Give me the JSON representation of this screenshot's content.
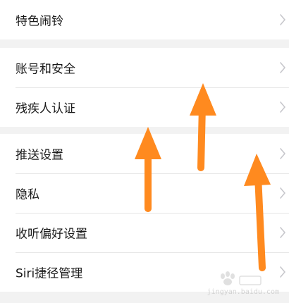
{
  "groups": [
    {
      "items": [
        {
          "label": "特色闹铃"
        }
      ]
    },
    {
      "items": [
        {
          "label": "账号和安全"
        },
        {
          "label": "残疾人认证"
        }
      ]
    },
    {
      "items": [
        {
          "label": "推送设置"
        },
        {
          "label": "隐私"
        },
        {
          "label": "收听偏好设置"
        },
        {
          "label": "Siri捷径管理"
        }
      ]
    }
  ],
  "icons": {
    "row_arrow": "chevron-right-icon",
    "annotation": "up-arrow-icon"
  },
  "colors": {
    "page_background": "#f2f2f2",
    "card_background": "#ffffff",
    "text": "#1a1a1a",
    "chevron": "#c7c7cc",
    "annotation_arrow": "#ff8a1f"
  },
  "watermark": {
    "text": "jingyan.baidu.com"
  }
}
